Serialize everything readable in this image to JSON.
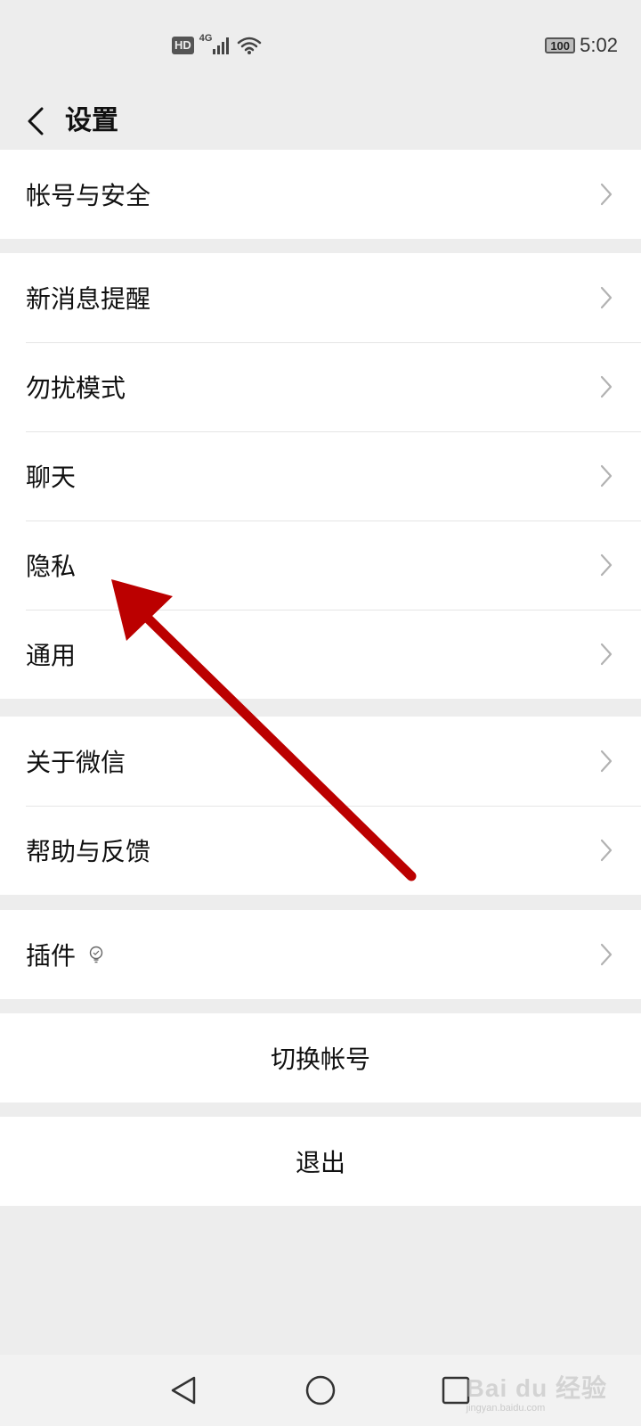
{
  "status_bar": {
    "hd": "HD",
    "network": "4G",
    "battery": "100",
    "time": "5:02"
  },
  "header": {
    "title": "设置",
    "back_icon": "chevron-left-icon"
  },
  "groups": [
    {
      "items": [
        {
          "label": "帐号与安全"
        }
      ]
    },
    {
      "items": [
        {
          "label": "新消息提醒"
        },
        {
          "label": "勿扰模式"
        },
        {
          "label": "聊天"
        },
        {
          "label": "隐私"
        },
        {
          "label": "通用"
        }
      ]
    },
    {
      "items": [
        {
          "label": "关于微信"
        },
        {
          "label": "帮助与反馈"
        }
      ]
    },
    {
      "items": [
        {
          "label": "插件",
          "icon": "lightbulb-icon"
        }
      ]
    }
  ],
  "actions": {
    "switch_account": "切换帐号",
    "logout": "退出"
  },
  "annotation": {
    "color": "#c00000",
    "points_to": "隐私"
  },
  "nav_bar": {
    "back_icon": "triangle-back-icon",
    "home_icon": "circle-home-icon",
    "recents_icon": "square-recents-icon"
  },
  "watermark": {
    "logo": "Bai du 经验",
    "sub": "jingyan.baidu.com"
  }
}
